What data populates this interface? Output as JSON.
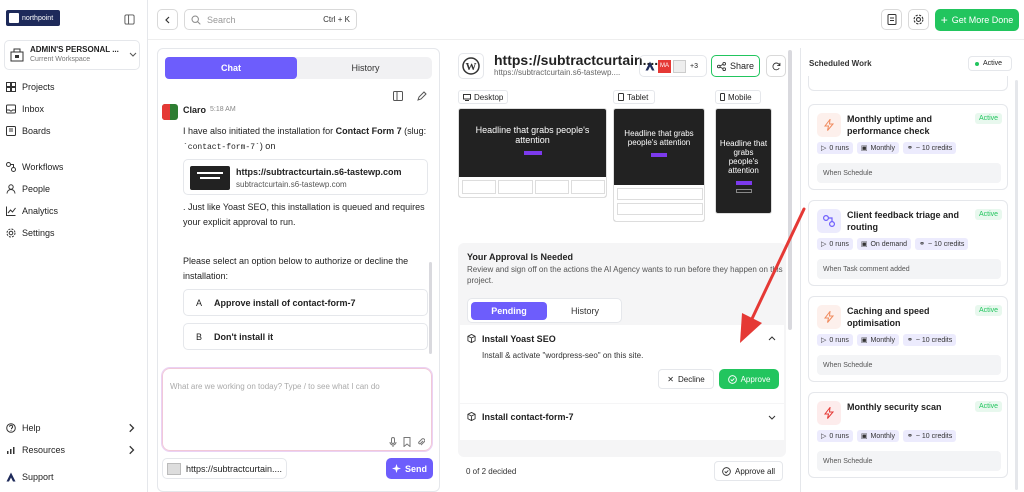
{
  "sidebar": {
    "brand": "northpoint",
    "workspace_name": "ADMIN'S PERSONAL ...",
    "workspace_sub": "Current Workspace",
    "nav": [
      "Projects",
      "Inbox",
      "Boards",
      "Workflows",
      "People",
      "Analytics",
      "Settings"
    ],
    "help": "Help",
    "resources": "Resources",
    "support": "Support"
  },
  "topbar": {
    "search_placeholder": "Search",
    "search_shortcut": "Ctrl + K",
    "cta": "Get More Done"
  },
  "chat": {
    "tabs": [
      "Chat",
      "History"
    ],
    "sender": "Claro",
    "time": "5:18 AM",
    "p1_a": "I have also initiated the installation for ",
    "p1_b": "Contact Form 7",
    "p1_c": " (slug:",
    "p1_code": "`contact-form-7`",
    "p1_d": ") on",
    "link_title": "https://subtractcurtain.s6-tastewp.com",
    "link_sub": "subtractcurtain.s6-tastewp.com",
    "p2": ". Just like Yoast SEO, this installation is queued and requires your explicit approval to run.",
    "p3": "Please select an option below to authorize or decline the installation:",
    "options": [
      {
        "key": "A",
        "label": "Approve install of contact-form-7"
      },
      {
        "key": "B",
        "label": "Don't install it"
      }
    ],
    "composer_placeholder": "What are we working on today? Type / to see what I can do",
    "context_chip": "https://subtractcurtain....",
    "send": "Send"
  },
  "site": {
    "title": "https://subtractcurtain....",
    "url": "https://subtractcurtain.s6-tastewp....",
    "avatar_more": "+3",
    "share": "Share",
    "devices": [
      "Desktop",
      "Tablet",
      "Mobile"
    ],
    "hero": "Headline that grabs people's attention",
    "approval_title": "Your Approval Is Needed",
    "approval_desc": "Review and sign off on the actions the AI Agency wants to run before they happen on this project.",
    "approval_tabs": [
      "Pending",
      "History"
    ],
    "item1_title": "Install Yoast SEO",
    "item1_desc": "Install & activate \"wordpress-seo\" on this site.",
    "decline": "Decline",
    "approve": "Approve",
    "item2_title": "Install contact-form-7",
    "decided": "0 of 2 decided",
    "approve_all": "Approve all"
  },
  "scheduled": {
    "title": "Scheduled Work",
    "status": "Active",
    "cards": [
      {
        "title": "Monthly uptime and performance check",
        "badge": "Active",
        "runs": "0 runs",
        "freq": "Monthly",
        "credits": "~ 10 credits",
        "when": "When Schedule"
      },
      {
        "title": "Client feedback triage and routing",
        "badge": "Active",
        "runs": "0 runs",
        "freq": "On demand",
        "credits": "~ 10 credits",
        "when": "When Task comment added"
      },
      {
        "title": "Caching and speed optimisation",
        "badge": "Active",
        "runs": "0 runs",
        "freq": "Monthly",
        "credits": "~ 10 credits",
        "when": "When Schedule"
      },
      {
        "title": "Monthly security scan",
        "badge": "Active",
        "runs": "0 runs",
        "freq": "Monthly",
        "credits": "~ 10 credits",
        "when": "When Schedule"
      }
    ]
  },
  "colors": {
    "accent": "#6d5dfc",
    "green": "#22c55e",
    "annotation_arrow": "#e53935"
  }
}
